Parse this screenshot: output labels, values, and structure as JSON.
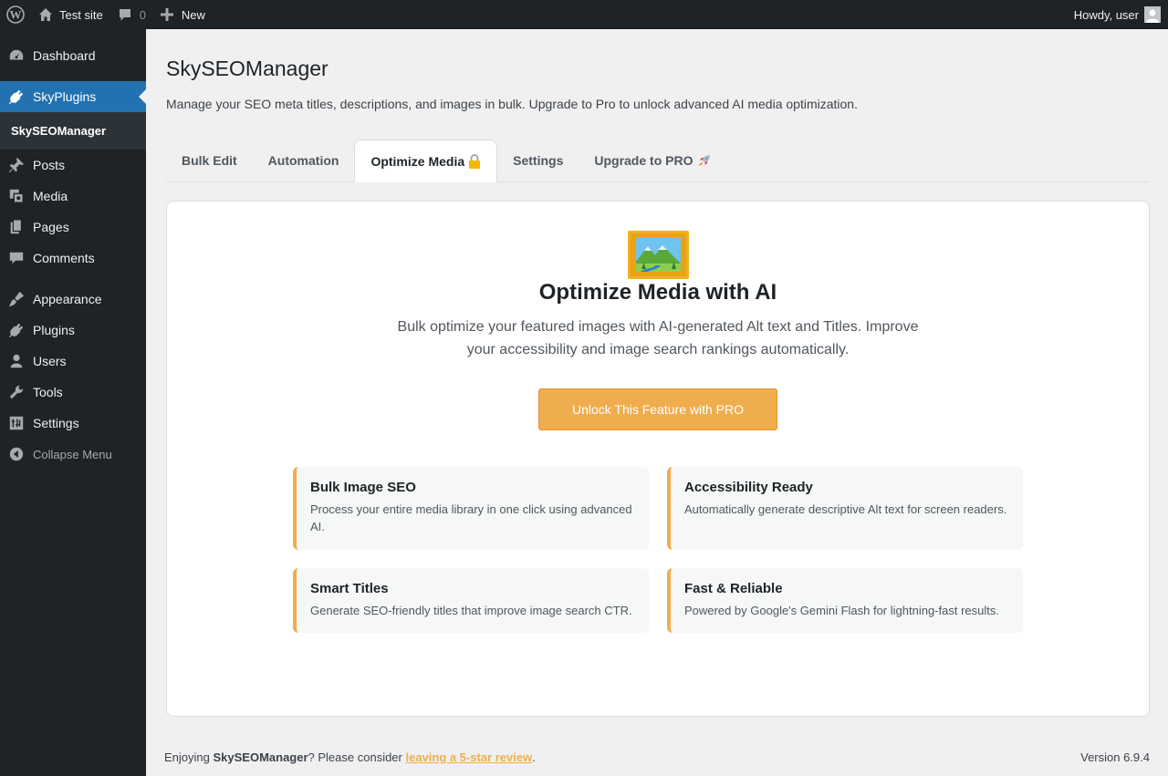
{
  "admin_bar": {
    "site_name": "Test site",
    "comments_count": "0",
    "new_label": "New",
    "greeting": "Howdy, user"
  },
  "sidebar": {
    "items": [
      {
        "label": "Dashboard",
        "icon": "dashboard-icon"
      },
      {
        "label": "SkyPlugins",
        "icon": "plugin-icon",
        "current": true
      },
      {
        "label": "Posts",
        "icon": "pin-icon"
      },
      {
        "label": "Media",
        "icon": "media-icon"
      },
      {
        "label": "Pages",
        "icon": "pages-icon"
      },
      {
        "label": "Comments",
        "icon": "comment-icon"
      },
      {
        "label": "Appearance",
        "icon": "brush-icon"
      },
      {
        "label": "Plugins",
        "icon": "plugin-icon"
      },
      {
        "label": "Users",
        "icon": "user-icon"
      },
      {
        "label": "Tools",
        "icon": "wrench-icon"
      },
      {
        "label": "Settings",
        "icon": "settings-icon"
      }
    ],
    "submenu": [
      "SkySEOManager"
    ],
    "collapse_label": "Collapse Menu"
  },
  "page": {
    "title": "SkySEOManager",
    "description": "Manage your SEO meta titles, descriptions, and images in bulk. Upgrade to Pro to unlock advanced AI media optimization."
  },
  "tabs": [
    {
      "label": "Bulk Edit",
      "emoji": ""
    },
    {
      "label": "Automation",
      "emoji": ""
    },
    {
      "label": "Optimize Media",
      "emoji": "🔒",
      "active": true
    },
    {
      "label": "Settings",
      "emoji": ""
    },
    {
      "label": "Upgrade to PRO",
      "emoji": "🚀"
    }
  ],
  "main": {
    "hero_icon": "framed-picture-icon",
    "title": "Optimize Media with AI",
    "description": "Bulk optimize your featured images with AI-generated Alt text and Titles. Improve your accessibility and image search rankings automatically.",
    "cta_label": "Unlock This Feature with PRO",
    "features": [
      {
        "title": "Bulk Image SEO",
        "text": "Process your entire media library in one click using advanced AI."
      },
      {
        "title": "Accessibility Ready",
        "text": "Automatically generate descriptive Alt text for screen readers."
      },
      {
        "title": "Smart Titles",
        "text": "Generate SEO-friendly titles that improve image search CTR."
      },
      {
        "title": "Fast & Reliable",
        "text": "Powered by Google's Gemini Flash for lightning-fast results."
      }
    ]
  },
  "footer": {
    "prefix": "Enjoying ",
    "plugin_name": "SkySEOManager",
    "middle": "? Please consider ",
    "link_text": "leaving a 5-star review",
    "suffix": ".",
    "version": "Version 6.9.4"
  },
  "colors": {
    "accent": "#f0ad4e",
    "admin_dark": "#1d2327",
    "wp_blue": "#2271b1"
  }
}
